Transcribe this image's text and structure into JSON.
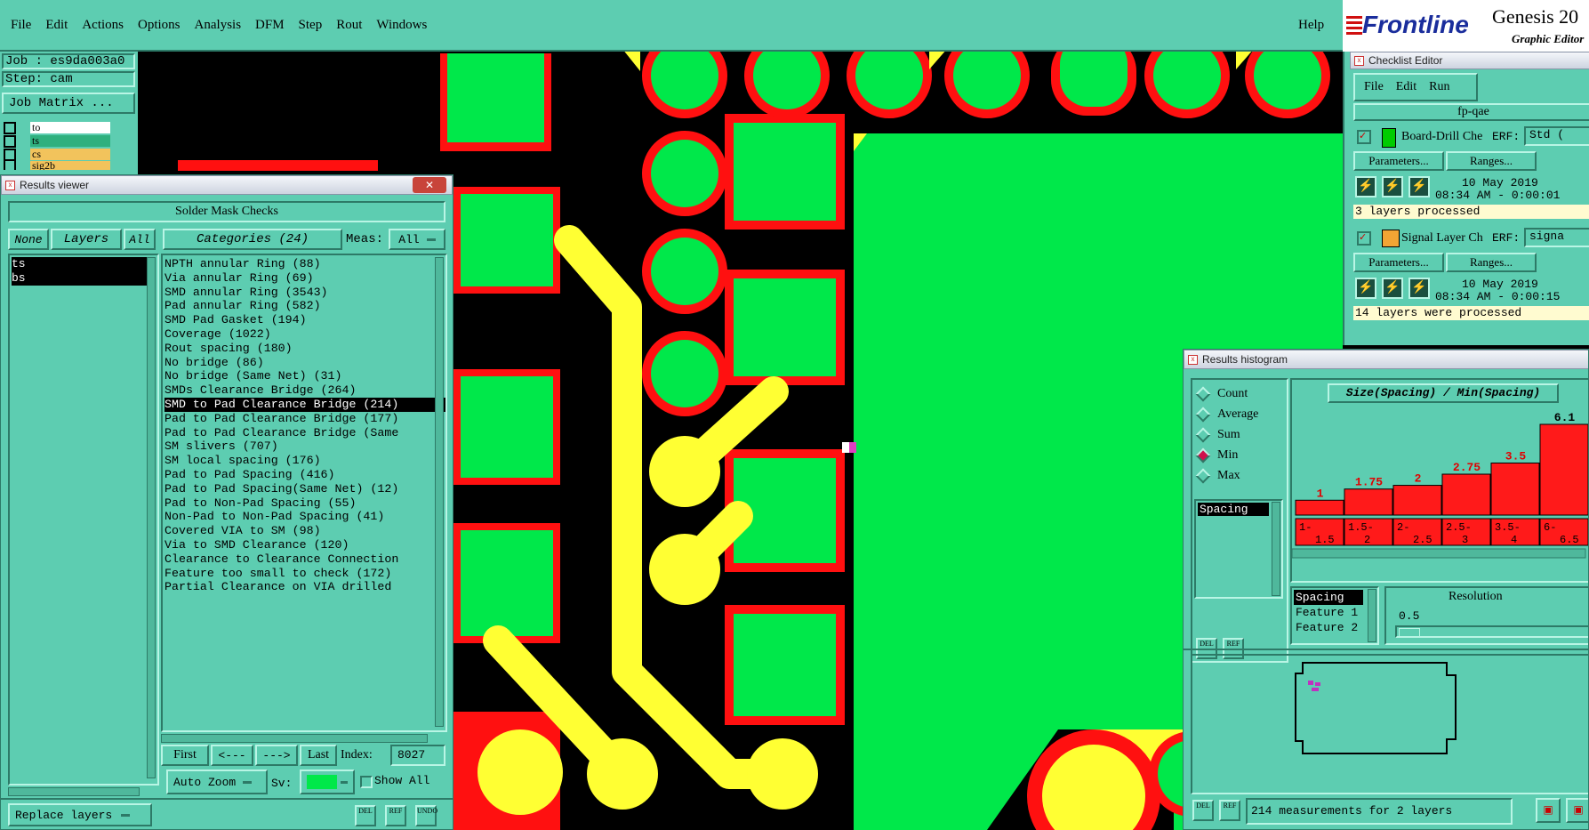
{
  "menu": {
    "items": [
      "File",
      "Edit",
      "Actions",
      "Options",
      "Analysis",
      "DFM",
      "Step",
      "Rout",
      "Windows"
    ],
    "help": "Help"
  },
  "brand": {
    "logo": "Frontline",
    "product": "Genesis 20",
    "subtitle": "Graphic Editor"
  },
  "job": {
    "job_line": "Job : es9da003a0",
    "step_line": "Step: cam",
    "matrix_button": "Job Matrix ..."
  },
  "layer_stack": [
    {
      "name": "to",
      "color": "#ffffff"
    },
    {
      "name": "ts",
      "color": "#2fb07e"
    },
    {
      "name": "cs",
      "color": "#f2c35c"
    },
    {
      "name": "sig2b",
      "color": "#f2c35c"
    }
  ],
  "results_viewer": {
    "window_title": "Results viewer",
    "header": "Solder Mask Checks",
    "none_btn": "None",
    "layers_btn": "Layers",
    "all_btn": "All",
    "categories_btn": "Categories (24)",
    "meas_label": "Meas:",
    "meas_value": "All",
    "layers": [
      "ts",
      "bs"
    ],
    "categories": [
      "NPTH annular Ring (88)",
      "Via annular Ring (69)",
      "SMD annular Ring (3543)",
      "Pad annular Ring (582)",
      "SMD Pad Gasket (194)",
      "Coverage (1022)",
      "Rout spacing (180)",
      "No bridge (86)",
      "No bridge (Same Net) (31)",
      "SMDs Clearance Bridge (264)",
      "SMD to Pad Clearance Bridge (214)",
      "Pad to Pad Clearance Bridge (177)",
      "Pad to Pad Clearance Bridge (Same",
      "SM slivers (707)",
      "SM local spacing (176)",
      "Pad to Pad Spacing (416)",
      "Pad to Pad Spacing(Same Net) (12)",
      "Pad to Non-Pad Spacing (55)",
      "Non-Pad to Non-Pad Spacing (41)",
      "Covered VIA to SM (98)",
      "Via to SMD Clearance (120)",
      "Clearance to Clearance Connection",
      "Feature too small to check (172)",
      "Partial Clearance on VIA drilled"
    ],
    "selected_category": 10,
    "nav": {
      "first": "First",
      "prev": "<---",
      "next": "--->",
      "last": "Last",
      "index_label": "Index:",
      "index_value": "8027"
    },
    "zoom_mode": "Auto Zoom",
    "sv_label": "Sv:",
    "show_all": "Show All",
    "replace_layers": "Replace layers",
    "icons": {
      "del": "DEL",
      "ref": "REF",
      "undo": "UNDO"
    }
  },
  "checklist": {
    "window_title": "Checklist Editor",
    "menu": [
      "File",
      "Edit",
      "Run"
    ],
    "name": "fp-qae",
    "checks": [
      {
        "name": "Board-Drill Che",
        "erf": "ERF:",
        "erf_value": "Std (",
        "params": "Parameters...",
        "ranges": "Ranges...",
        "date": "10 May 2019",
        "time": "08:34 AM - 0:00:01",
        "status": "3 layers processed"
      },
      {
        "name": "Signal Layer Ch",
        "erf": "ERF:",
        "erf_value": "signa",
        "params": "Parameters...",
        "ranges": "Ranges...",
        "date": "10 May 2019",
        "time": "08:34 AM - 0:00:15",
        "status": "14 layers were processed"
      }
    ]
  },
  "histogram": {
    "window_title": "Results histogram",
    "options": [
      "Count",
      "Average",
      "Sum",
      "Min",
      "Max"
    ],
    "selected_option": "Min",
    "measure_list": [
      "Spacing"
    ],
    "title": "Size(Spacing) / Min(Spacing)",
    "fields": [
      "Spacing",
      "Feature 1",
      "Feature 2"
    ],
    "resolution_label": "Resolution",
    "resolution_value": "0.5",
    "status": "214 measurements for 2 layers",
    "icons": {
      "del": "DEL",
      "ref": "REF"
    }
  },
  "chart_data": {
    "type": "bar",
    "title": "Size(Spacing) / Min(Spacing)",
    "categories": [
      "1-1.5",
      "1.5-2",
      "2-2.5",
      "2.5-3",
      "3.5-4",
      "6-6.5"
    ],
    "values": [
      1,
      1.75,
      2,
      2.75,
      3.5,
      6.1
    ],
    "value_labels": [
      "1",
      "1.75",
      "2",
      "2.75",
      "3.5",
      "6.1"
    ],
    "bar_color": "#ff1a1a",
    "ylim": [
      0,
      6.1
    ]
  },
  "colors": {
    "panel": "#5dcdb1",
    "mask": "#00e84a",
    "pad": "#ff1010",
    "trace": "#ffff33",
    "background": "#000000"
  }
}
